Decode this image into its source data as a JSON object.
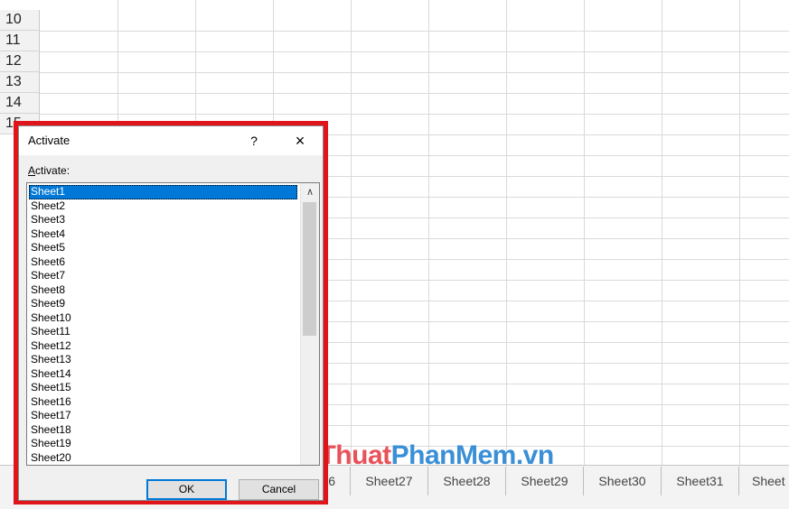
{
  "spreadsheet": {
    "row_numbers": [
      "10",
      "11",
      "12",
      "13",
      "14",
      "15"
    ]
  },
  "sheet_tabs": [
    "6",
    "Sheet27",
    "Sheet28",
    "Sheet29",
    "Sheet30",
    "Sheet31",
    "Sheet"
  ],
  "watermark": {
    "part1": "ThuThuat",
    "part2": "PhanMem.vn"
  },
  "dialog": {
    "title": "Activate",
    "help_icon": "?",
    "close_icon": "×",
    "field_label_accel": "A",
    "field_label_rest": "ctivate:",
    "selected_index": 0,
    "sheets": [
      "Sheet1",
      "Sheet2",
      "Sheet3",
      "Sheet4",
      "Sheet5",
      "Sheet6",
      "Sheet7",
      "Sheet8",
      "Sheet9",
      "Sheet10",
      "Sheet11",
      "Sheet12",
      "Sheet13",
      "Sheet14",
      "Sheet15",
      "Sheet16",
      "Sheet17",
      "Sheet18",
      "Sheet19",
      "Sheet20"
    ],
    "ok_label": "OK",
    "cancel_label": "Cancel"
  },
  "colors": {
    "highlight_border": "#e0141b",
    "selection": "#0078d7"
  }
}
